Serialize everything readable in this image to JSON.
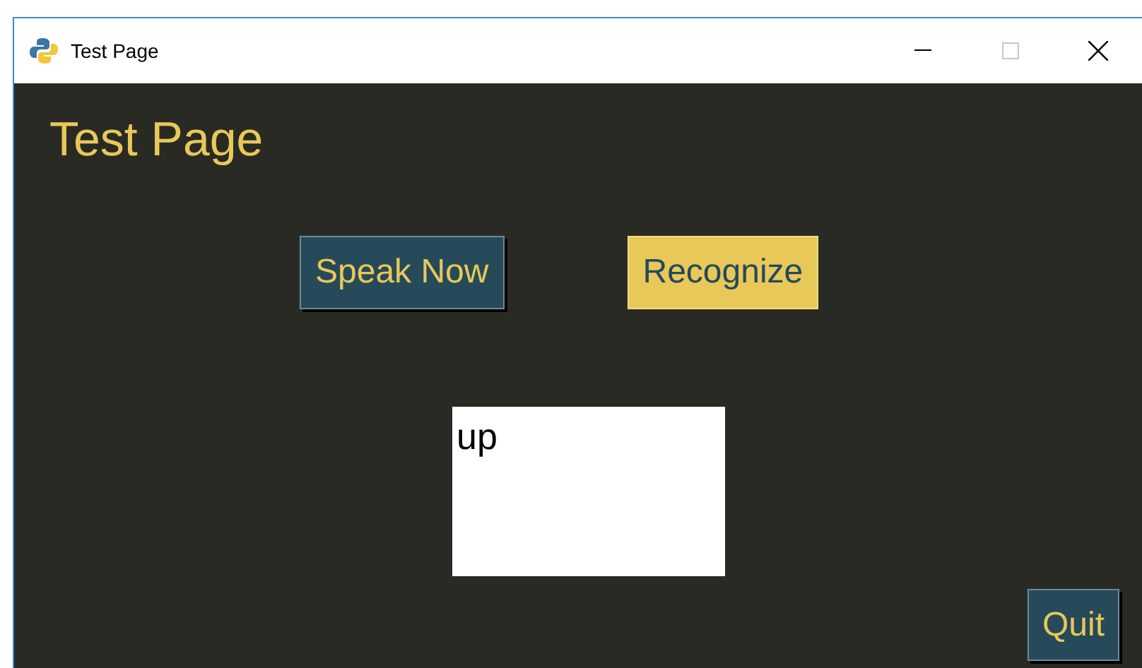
{
  "window": {
    "title": "Test Page"
  },
  "heading": "Test Page",
  "buttons": [
    {
      "label": "Speak Now",
      "active": false
    },
    {
      "label": "Recognize",
      "active": true
    }
  ],
  "text_box": {
    "value": "up"
  },
  "quit_button": {
    "label": "Quit",
    "active": false
  }
}
